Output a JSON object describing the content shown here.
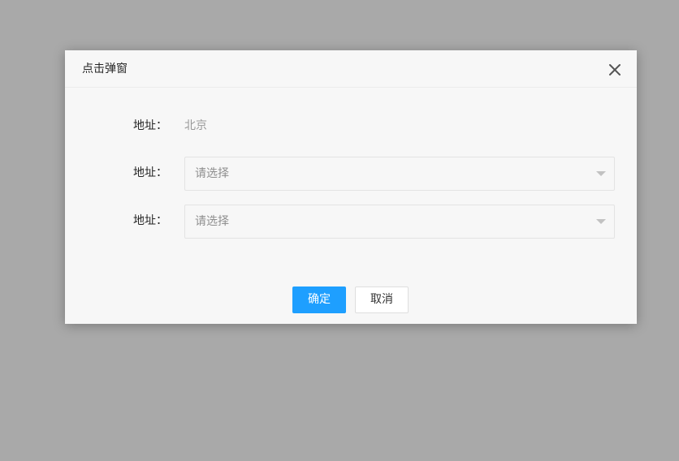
{
  "dialog": {
    "title": "点击弹窗",
    "close_icon": "close-icon",
    "fields": [
      {
        "label": "地址：",
        "value": "北京"
      },
      {
        "label": "地址：",
        "placeholder": "请选择",
        "icon": "chevron-down-icon"
      },
      {
        "label": "地址：",
        "placeholder": "请选择",
        "icon": "chevron-down-icon"
      }
    ],
    "buttons": {
      "confirm": "确定",
      "cancel": "取消"
    }
  },
  "colors": {
    "primary": "#1e9fff",
    "overlay": "#a9a9a9",
    "dialog_bg": "#f7f7f7"
  }
}
